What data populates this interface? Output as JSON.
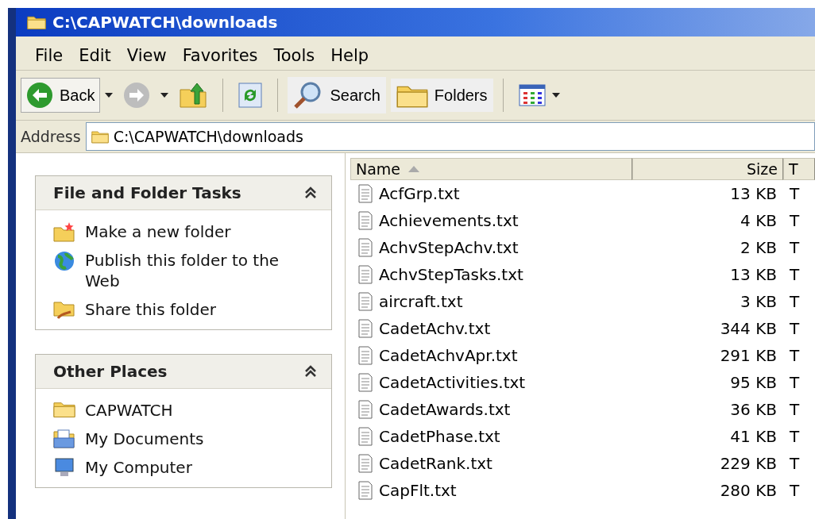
{
  "window": {
    "title": "C:\\CAPWATCH\\downloads"
  },
  "menu": [
    "File",
    "Edit",
    "View",
    "Favorites",
    "Tools",
    "Help"
  ],
  "toolbar": [
    {
      "kind": "back",
      "label": "Back"
    },
    {
      "kind": "forward"
    },
    {
      "kind": "up"
    },
    {
      "kind": "refresh"
    },
    {
      "kind": "search",
      "label": "Search"
    },
    {
      "kind": "folders",
      "label": "Folders"
    },
    {
      "kind": "views"
    }
  ],
  "address": {
    "label": "Address",
    "value": "C:\\CAPWATCH\\downloads"
  },
  "task_panels": [
    {
      "title": "File and Folder Tasks",
      "expanded": true,
      "items": [
        {
          "kind": "newfolder",
          "label": "Make a new folder"
        },
        {
          "kind": "web",
          "label": "Publish this folder to the Web"
        },
        {
          "kind": "share",
          "label": "Share this folder"
        }
      ]
    },
    {
      "title": "Other Places",
      "expanded": true,
      "items": [
        {
          "kind": "folder",
          "label": "CAPWATCH"
        },
        {
          "kind": "documents",
          "label": "My Documents"
        },
        {
          "kind": "computer",
          "label": "My Computer"
        }
      ]
    }
  ],
  "table": {
    "columns": [
      "Name",
      "Size",
      "T"
    ],
    "rows": [
      {
        "name": "AcfGrp.txt",
        "size": "13 KB",
        "column_3": "T"
      },
      {
        "name": "Achievements.txt",
        "size": "4 KB",
        "column_3": "T"
      },
      {
        "name": "AchvStepAchv.txt",
        "size": "2 KB",
        "column_3": "T"
      },
      {
        "name": "AchvStepTasks.txt",
        "size": "13 KB",
        "column_3": "T"
      },
      {
        "name": "aircraft.txt",
        "size": "3 KB",
        "column_3": "T"
      },
      {
        "name": "CadetAchv.txt",
        "size": "344 KB",
        "column_3": "T"
      },
      {
        "name": "CadetAchvApr.txt",
        "size": "291 KB",
        "column_3": "T"
      },
      {
        "name": "CadetActivities.txt",
        "size": "95 KB",
        "column_3": "T"
      },
      {
        "name": "CadetAwards.txt",
        "size": "36 KB",
        "column_3": "T"
      },
      {
        "name": "CadetPhase.txt",
        "size": "41 KB",
        "column_3": "T"
      },
      {
        "name": "CadetRank.txt",
        "size": "229 KB",
        "column_3": "T"
      },
      {
        "name": "CapFlt.txt",
        "size": "280 KB",
        "column_3": "T"
      }
    ]
  }
}
